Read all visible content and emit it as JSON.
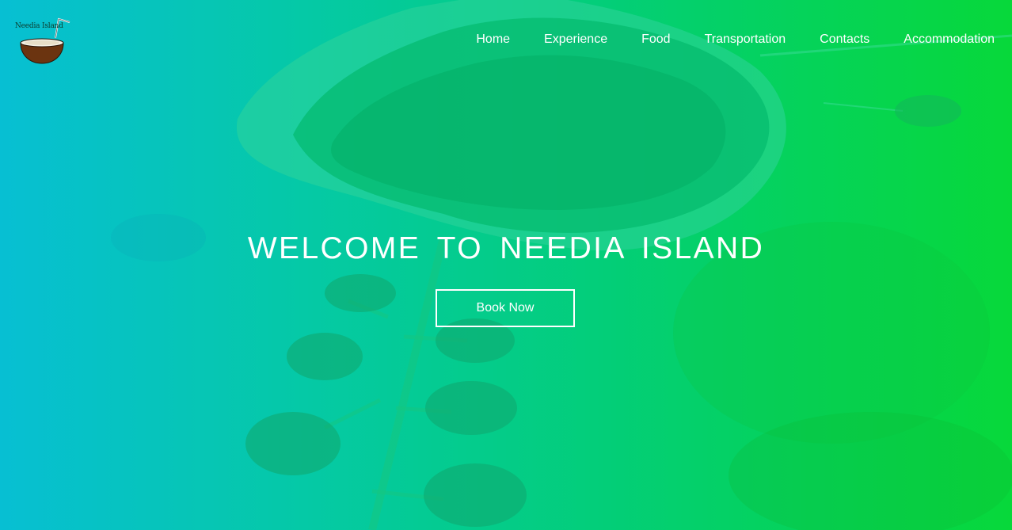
{
  "brand": {
    "logo_text": "Needia Island"
  },
  "nav": {
    "items": [
      "Home",
      "Experience",
      "Food",
      "Transportation",
      "Contacts",
      "Accommodation"
    ]
  },
  "hero": {
    "title": "WELCOME TO NEEDIA ISLAND",
    "cta_label": "Book Now"
  },
  "colors": {
    "gradient_start": "#07bfd3",
    "gradient_end": "#07d83a",
    "text": "#ffffff",
    "coconut_shell": "#6b3410"
  }
}
